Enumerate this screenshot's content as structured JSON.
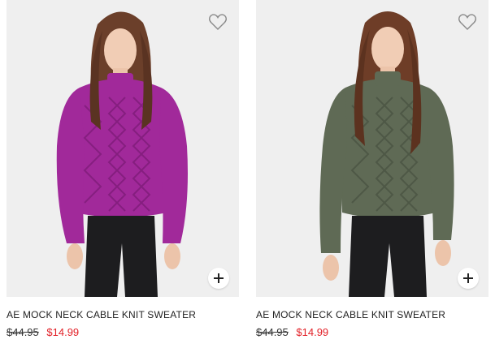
{
  "products": [
    {
      "name": "AE MOCK NECK CABLE KNIT SWEATER",
      "original_price": "$44.95",
      "sale_price": "$14.99",
      "sweater_color": "#a1299a",
      "sweater_shade": "#7f1c79"
    },
    {
      "name": "AE MOCK NECK CABLE KNIT SWEATER",
      "original_price": "$44.95",
      "sale_price": "$14.99",
      "sweater_color": "#5f6a55",
      "sweater_shade": "#4a5443"
    }
  ],
  "colors": {
    "sale": "#e21f26",
    "photo_background": "#efefef"
  },
  "icons": {
    "favorite": "heart-icon",
    "add": "plus-icon"
  }
}
